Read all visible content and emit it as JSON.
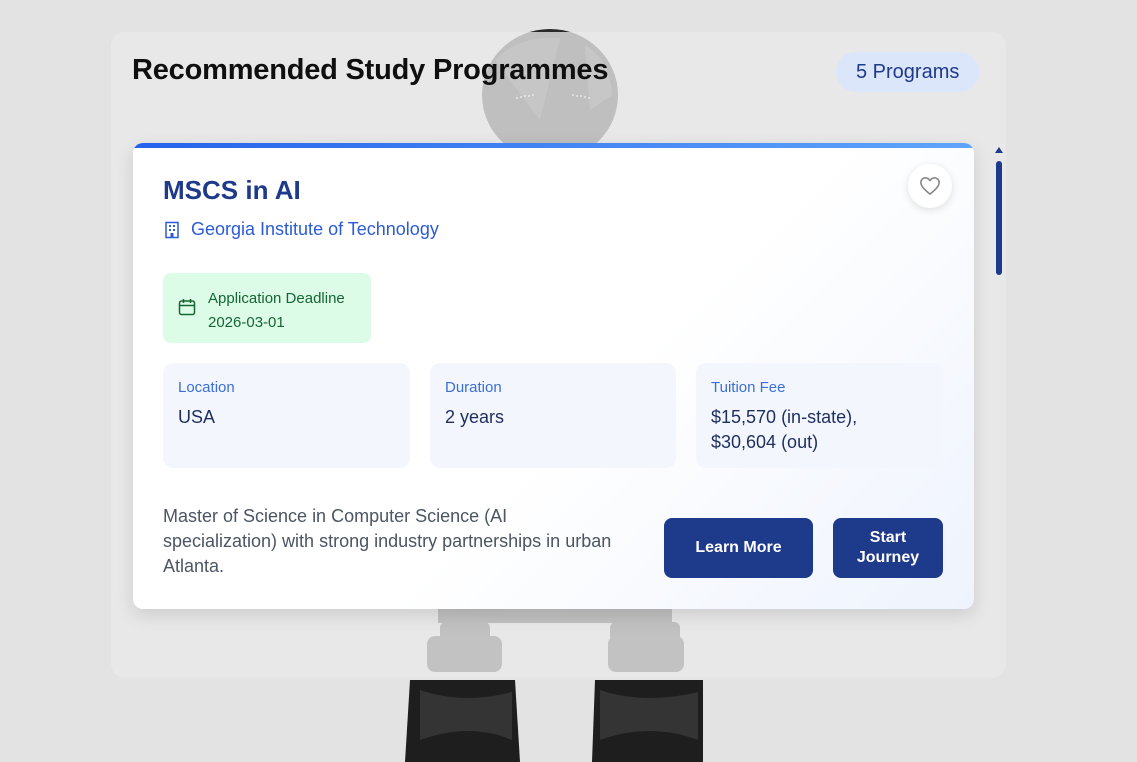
{
  "header": {
    "title": "Recommended Study Programmes",
    "count_badge": "5 Programs"
  },
  "program": {
    "title": "MSCS in AI",
    "university": "Georgia Institute of Technology",
    "deadline": {
      "label": "Application Deadline",
      "date": "2026-03-01"
    },
    "details": [
      {
        "label": "Location",
        "value": "USA"
      },
      {
        "label": "Duration",
        "value": "2 years"
      },
      {
        "label": "Tuition Fee",
        "value": "$15,570 (in-state), $30,604 (out)"
      }
    ],
    "description": "Master of Science in Computer Science (AI specialization) with strong industry partnerships in urban Atlanta.",
    "buttons": {
      "learn_more": "Learn More",
      "start_journey": "Start Journey"
    }
  },
  "icons": {
    "favorite": "heart-icon",
    "university": "building-icon",
    "deadline": "calendar-icon"
  },
  "colors": {
    "accent": "#1e3a8a",
    "link": "#2b5bd7",
    "deadline_bg": "#dcfce7",
    "deadline_text": "#166534",
    "badge_bg": "#dbe6fb"
  }
}
